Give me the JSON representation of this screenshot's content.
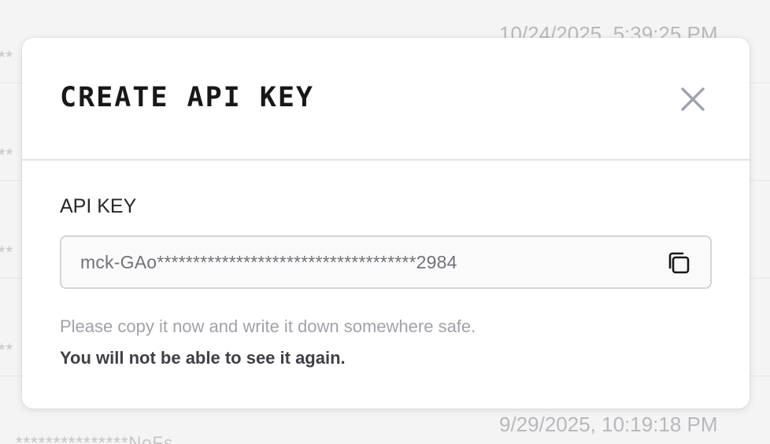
{
  "background": {
    "timestamps": [
      "10/24/2025, 5:39:25 PM",
      "9/29/2025, 10:19:18 PM"
    ],
    "masked_key_fragments": [
      "**",
      "**",
      "**",
      "**",
      "***************NoFs"
    ]
  },
  "modal": {
    "title": "CREATE API KEY",
    "close_icon": "close-icon",
    "field_label": "API KEY",
    "api_key_value": "mck-GAo************************************2984",
    "copy_icon": "copy-icon",
    "note": "Please copy it now and write it down somewhere safe.",
    "warning": "You will not be able to see it again."
  },
  "colors": {
    "title": "#18181b",
    "icon_gray": "#9ca3af",
    "note_gray": "#a1a1aa",
    "warning": "#3f3f46",
    "field_bg": "#fafafa",
    "field_border": "#d4d4d8"
  }
}
